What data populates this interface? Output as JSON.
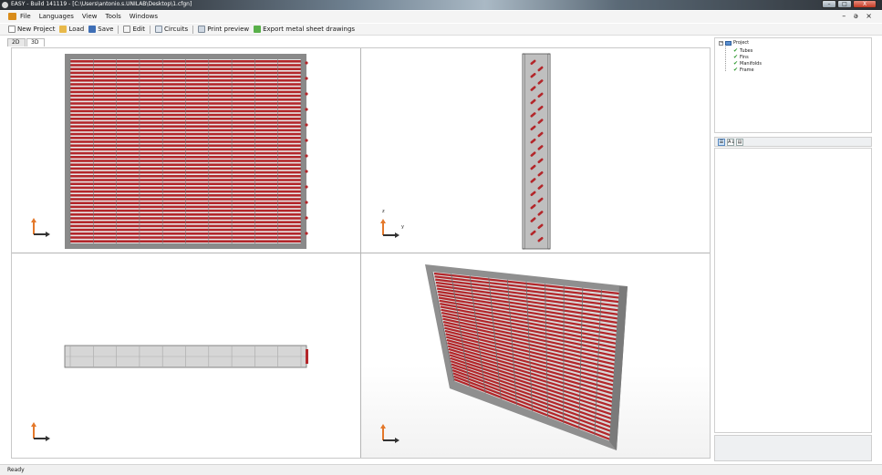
{
  "window": {
    "title": "EASY - Build 141119 - [C:\\Users\\antonio.s.UNILAB\\Desktop\\1.cfgn]",
    "minimize_label": "–",
    "maximize_label": "□",
    "close_label": "X",
    "mdi_controls": "– ə ×"
  },
  "menu": {
    "items": [
      "File",
      "Languages",
      "View",
      "Tools",
      "Windows"
    ]
  },
  "toolbar": {
    "new_project": "New Project",
    "load": "Load",
    "save": "Save",
    "edit": "Edit",
    "circuits": "Circuits",
    "print_preview": "Print preview",
    "export": "Export metal sheet drawings"
  },
  "tabs": [
    "2D",
    "3D"
  ],
  "views": {
    "side_axis_z": "z",
    "side_axis_y": "y"
  },
  "tree": {
    "root": "Project",
    "children": [
      "Tubes",
      "Fins",
      "Manifolds",
      "Frame"
    ]
  },
  "properties": {
    "categorized_icon": "☰",
    "alpha_icon": "Α↓",
    "pages_icon": "▤"
  },
  "status": {
    "text": "Ready"
  },
  "colors": {
    "tube_red": "#b3262a",
    "frame_gray": "#8a8a8a",
    "axis_orange": "#e4782a",
    "axis_dark": "#333333"
  }
}
